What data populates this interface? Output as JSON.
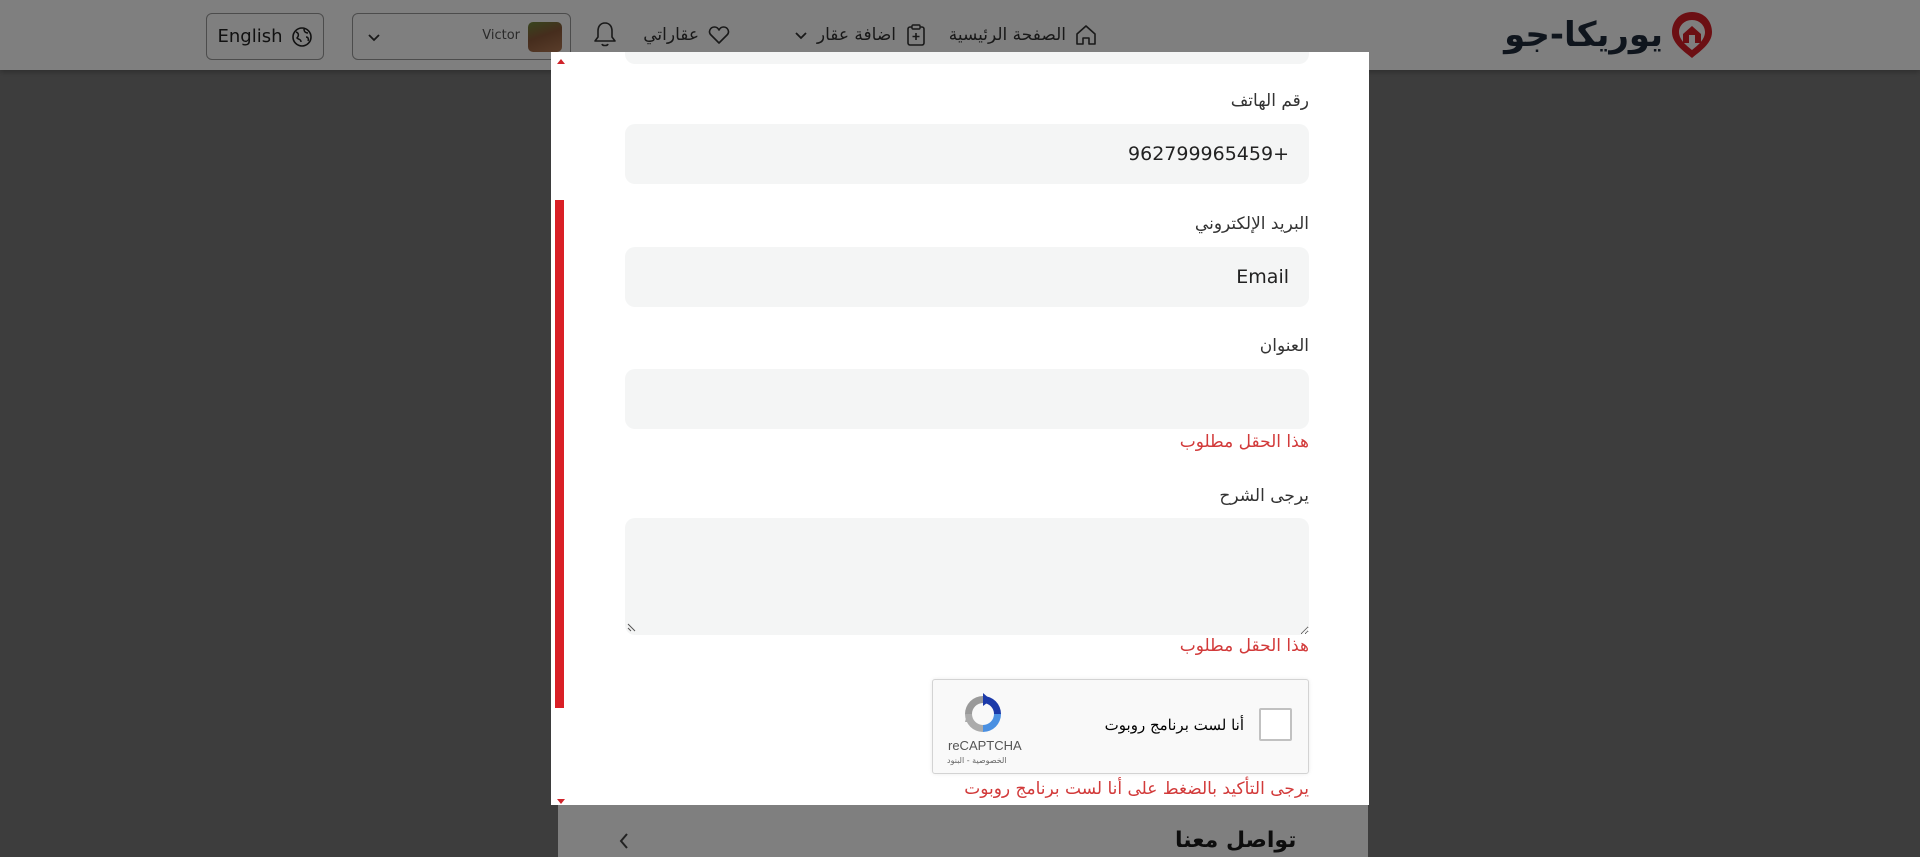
{
  "header": {
    "brand_name": "يوريكا-جو",
    "nav": {
      "home": "الصفحة الرئيسية",
      "add_property": "اضافة عقار",
      "my_properties": "عقاراتي"
    },
    "user_name": "Victor",
    "language_button": "English"
  },
  "background": {
    "footer_section_title": "تواصل معنا"
  },
  "form": {
    "phone_label": "رقم الهاتف",
    "phone_value": "962799965459+",
    "email_label": "البريد الإلكتروني",
    "email_placeholder": "Email",
    "address_label": "العنوان",
    "address_value": "",
    "address_error": "هذا الحقل مطلوب",
    "explain_label": "يرجى الشرح",
    "explain_error": "هذا الحقل مطلوب",
    "captcha_error": "يرجى التأكيد بالضغط على أنا لست برنامج روبوت"
  },
  "recaptcha": {
    "label": "أنا لست برنامج روبوت",
    "brand": "reCAPTCHA",
    "terms": "الخصوصية - البنود"
  },
  "colors": {
    "brand_red": "#d91f26",
    "error_red": "#d23a3a",
    "field_bg": "#f4f5f5"
  }
}
